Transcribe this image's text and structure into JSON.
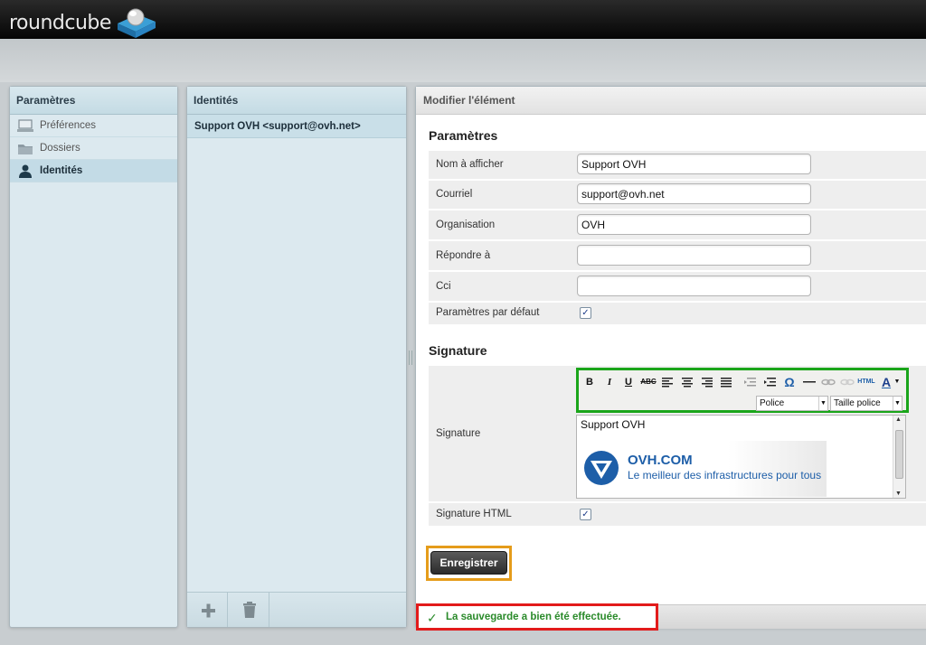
{
  "app": {
    "logo": "roundcube"
  },
  "settings_panel": {
    "title": "Paramètres",
    "items": [
      {
        "label": "Préférences",
        "icon": "computer-icon",
        "active": false
      },
      {
        "label": "Dossiers",
        "icon": "folder-icon",
        "active": false
      },
      {
        "label": "Identités",
        "icon": "person-icon",
        "active": true
      }
    ]
  },
  "identities_panel": {
    "title": "Identités",
    "selected": "Support OVH <support@ovh.net>",
    "footer": {
      "add_icon": "plus-icon",
      "delete_icon": "trash-icon"
    }
  },
  "edit_panel": {
    "title": "Modifier l'élément",
    "section_params": "Paramètres",
    "fields": {
      "name_label": "Nom à afficher",
      "name_value": "Support OVH",
      "email_label": "Courriel",
      "email_value": "support@ovh.net",
      "org_label": "Organisation",
      "org_value": "OVH",
      "reply_label": "Répondre à",
      "reply_value": "",
      "bcc_label": "Cci",
      "bcc_value": "",
      "default_label": "Paramètres par défaut",
      "default_checked": true
    },
    "section_signature": "Signature",
    "signature": {
      "label": "Signature",
      "text": "Support OVH",
      "image_brand": "OVH.COM",
      "image_tagline": "Le meilleur des infrastructures pour tous",
      "html_label": "Signature HTML",
      "html_checked": true
    },
    "toolbar": {
      "font_select": "Police",
      "size_select": "Taille police",
      "html_button": "HTML"
    },
    "save_button": "Enregistrer",
    "status_message": "La sauvegarde a bien été effectuée."
  },
  "colors": {
    "toolbar_highlight": "#1aa51a",
    "save_highlight": "#e59c1a",
    "status_highlight": "#e21b1b",
    "success_text": "#2a8a2a"
  }
}
